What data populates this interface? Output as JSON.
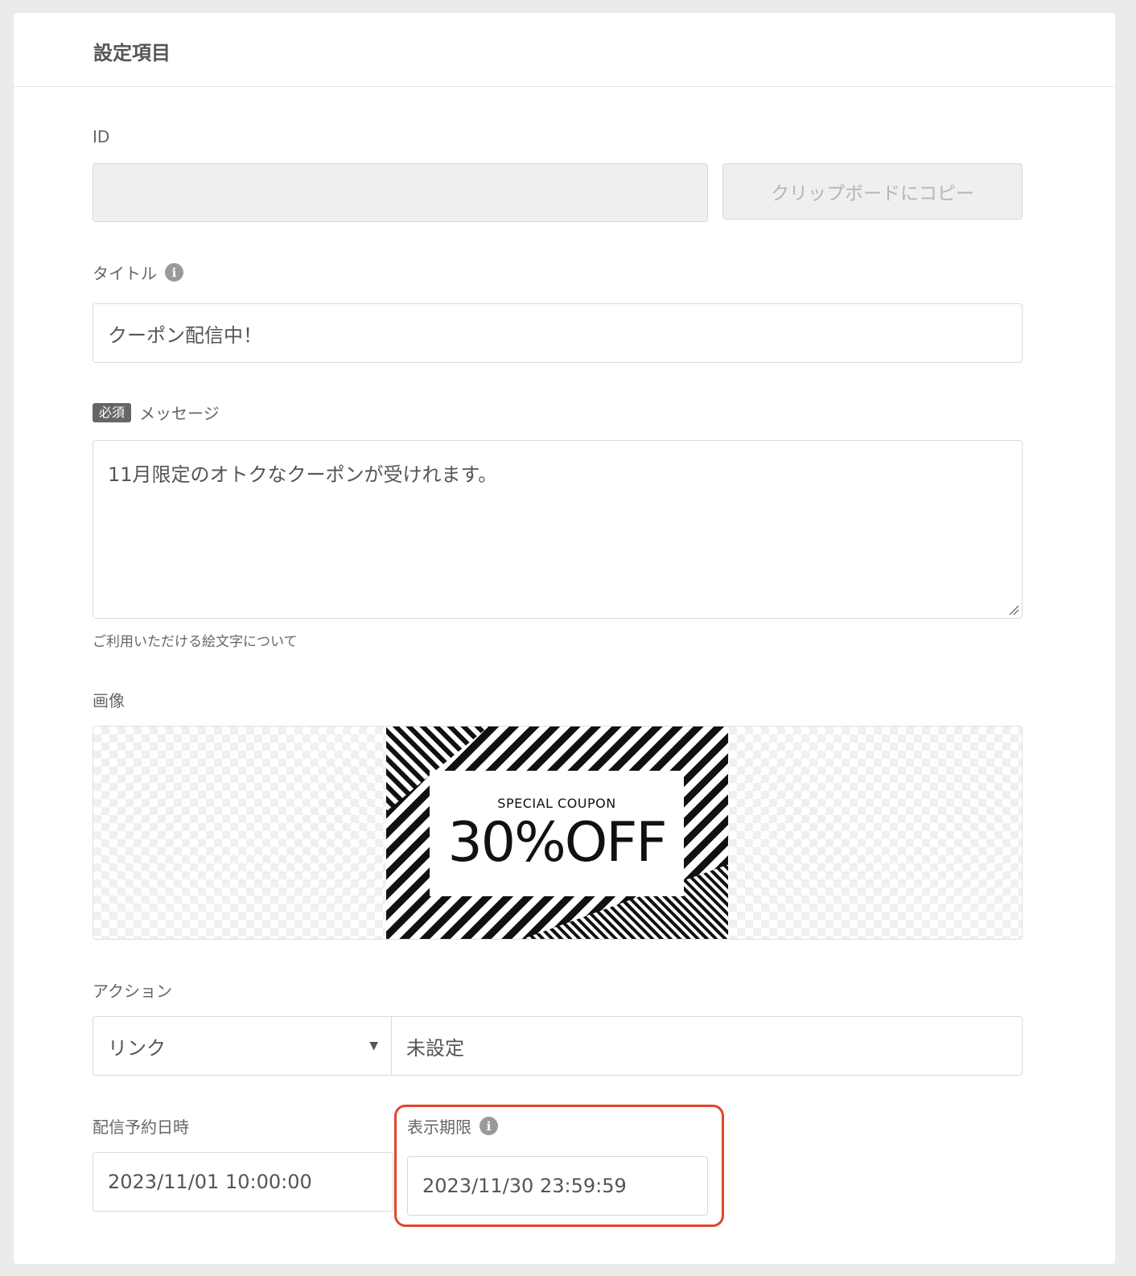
{
  "header": {
    "title": "設定項目"
  },
  "id_section": {
    "label": "ID",
    "value": "",
    "copy_button": "クリップボードにコピー"
  },
  "title_section": {
    "label": "タイトル",
    "info_icon": "info-icon",
    "value": "クーポン配信中！"
  },
  "message_section": {
    "required_badge": "必須",
    "label": "メッセージ",
    "value": "11月限定のオトクなクーポンが受けれます。",
    "emoji_link": "ご利用いただける絵文字について"
  },
  "image_section": {
    "label": "画像",
    "coupon": {
      "subtitle": "SPECIAL COUPON",
      "headline": "30%OFF"
    }
  },
  "action_section": {
    "label": "アクション",
    "type_value": "リンク",
    "target_value": "未設定"
  },
  "schedule_section": {
    "label": "配信予約日時",
    "value": "2023/11/01 10:00:00"
  },
  "expiry_section": {
    "label": "表示期限",
    "info_icon": "info-icon",
    "value": "2023/11/30 23:59:59",
    "highlight_color": "#e2462b"
  }
}
